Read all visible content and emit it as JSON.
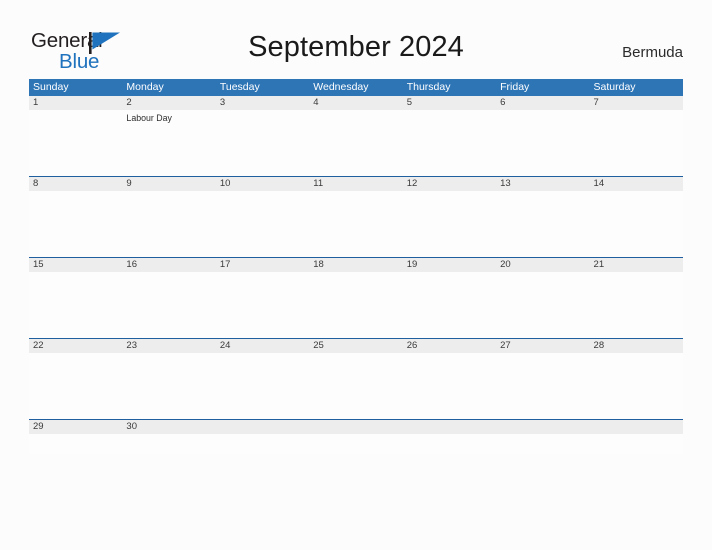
{
  "brand": {
    "name_part1": "General",
    "name_part2": "Blue",
    "flag_icon": "blue-triangle-flag-icon",
    "color_dark": "#231f20",
    "color_blue": "#1f72bd"
  },
  "header": {
    "title": "September 2024",
    "country": "Bermuda"
  },
  "colors": {
    "header_blue": "#2e75b6",
    "row_divider": "#1f5fa0",
    "date_band_gray": "#ededed",
    "page_background": "#fcfcfc"
  },
  "calendar": {
    "day_headers": [
      "Sunday",
      "Monday",
      "Tuesday",
      "Wednesday",
      "Thursday",
      "Friday",
      "Saturday"
    ],
    "weeks": [
      {
        "days": [
          {
            "date": "1",
            "event": ""
          },
          {
            "date": "2",
            "event": "Labour Day"
          },
          {
            "date": "3",
            "event": ""
          },
          {
            "date": "4",
            "event": ""
          },
          {
            "date": "5",
            "event": ""
          },
          {
            "date": "6",
            "event": ""
          },
          {
            "date": "7",
            "event": ""
          }
        ]
      },
      {
        "days": [
          {
            "date": "8",
            "event": ""
          },
          {
            "date": "9",
            "event": ""
          },
          {
            "date": "10",
            "event": ""
          },
          {
            "date": "11",
            "event": ""
          },
          {
            "date": "12",
            "event": ""
          },
          {
            "date": "13",
            "event": ""
          },
          {
            "date": "14",
            "event": ""
          }
        ]
      },
      {
        "days": [
          {
            "date": "15",
            "event": ""
          },
          {
            "date": "16",
            "event": ""
          },
          {
            "date": "17",
            "event": ""
          },
          {
            "date": "18",
            "event": ""
          },
          {
            "date": "19",
            "event": ""
          },
          {
            "date": "20",
            "event": ""
          },
          {
            "date": "21",
            "event": ""
          }
        ]
      },
      {
        "days": [
          {
            "date": "22",
            "event": ""
          },
          {
            "date": "23",
            "event": ""
          },
          {
            "date": "24",
            "event": ""
          },
          {
            "date": "25",
            "event": ""
          },
          {
            "date": "26",
            "event": ""
          },
          {
            "date": "27",
            "event": ""
          },
          {
            "date": "28",
            "event": ""
          }
        ]
      },
      {
        "days": [
          {
            "date": "29",
            "event": ""
          },
          {
            "date": "30",
            "event": ""
          },
          {
            "date": "",
            "event": ""
          },
          {
            "date": "",
            "event": ""
          },
          {
            "date": "",
            "event": ""
          },
          {
            "date": "",
            "event": ""
          },
          {
            "date": "",
            "event": ""
          }
        ]
      }
    ]
  }
}
